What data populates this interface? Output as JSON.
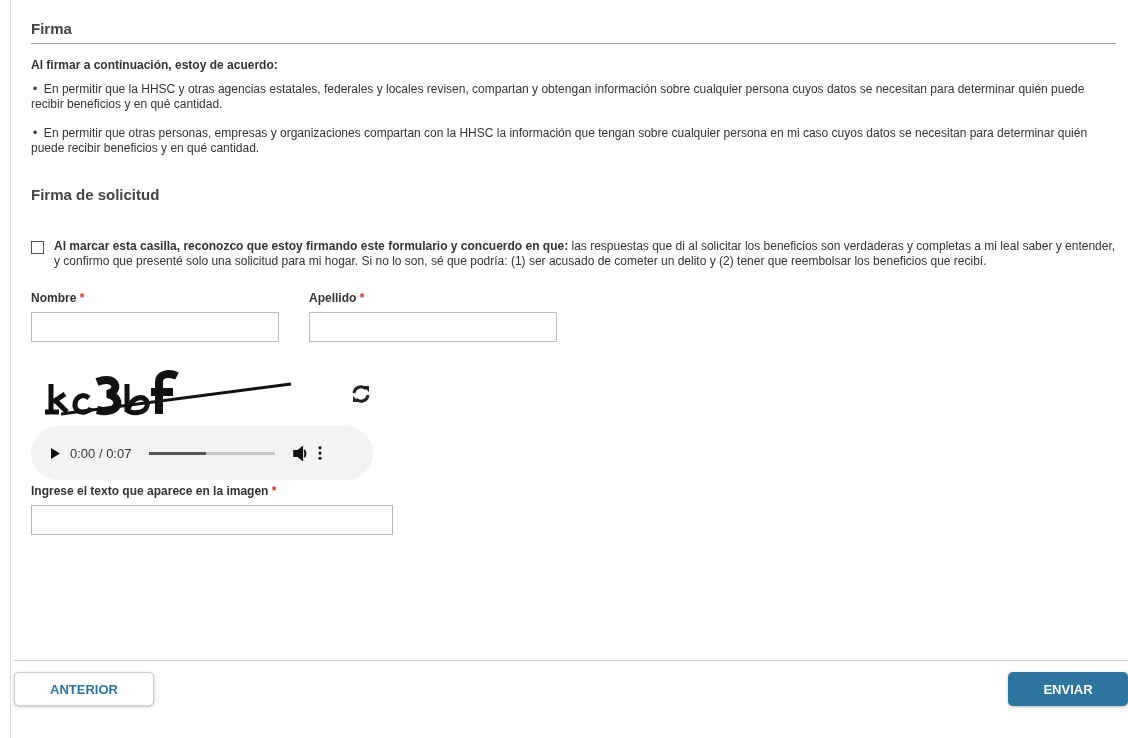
{
  "section_title": "Firma",
  "agreement": {
    "heading": "Al firmar a continuación, estoy de acuerdo:",
    "bullet": "•",
    "items": [
      "En permitir que la HHSC y otras agencias estatales, federales y locales revisen, compartan y obtengan información sobre cualquier persona cuyos datos se necesitan para determinar quién puede recibir beneficios y en qué cantidad.",
      "En permitir que otras personas, empresas y organizaciones compartan con la HHSC la información que tengan sobre cualquier persona en mi caso cuyos datos se necesitan para determinar quién puede recibir beneficios y en qué cantidad."
    ]
  },
  "signature": {
    "title": "Firma de solicitud",
    "checked": false,
    "text": "**Al marcar esta casilla, reconozco que estoy firmando este formulario y concuerdo en que:** las respuestas que di al solicitar los beneficios son verdaderas y completas a mi leal saber y entender, y confirmo que presenté solo una solicitud para mi hogar. Si no lo son, sé que podría: (1) ser acusado de cometer un delito y (2) tener que reembolsar los beneficios que recibí."
  },
  "fields": [
    {
      "label": "Nombre",
      "required_mark": "*"
    },
    {
      "label": "Apellido",
      "required_mark": "*"
    }
  ],
  "captcha": {
    "audio": {
      "time": "0:00 / 0:07",
      "level": 0.45
    },
    "field": {
      "label": "Ingrese el texto que aparece en la imagen",
      "required_mark": "*"
    }
  },
  "buttons": [
    {
      "label": "ANTERIOR",
      "kind": "secondary"
    },
    {
      "label": "ENVIAR",
      "kind": "primary"
    }
  ]
}
